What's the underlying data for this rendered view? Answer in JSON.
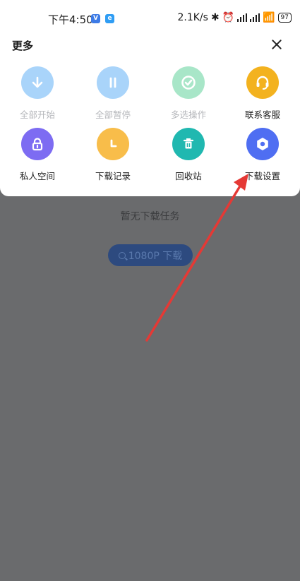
{
  "status_bar": {
    "time": "下午4:50",
    "app_icon_1": "V",
    "app_icon_2": "e",
    "net_speed": "2.1K/s",
    "battery": "97"
  },
  "header": {
    "title": "更多"
  },
  "menu": {
    "items": [
      {
        "label": "全部开始",
        "icon": "download-icon",
        "color": "#a9d4fa",
        "enabled": false
      },
      {
        "label": "全部暂停",
        "icon": "pause-icon",
        "color": "#a9d4fa",
        "enabled": false
      },
      {
        "label": "多选操作",
        "icon": "check-circle-icon",
        "color": "#a8e6c8",
        "enabled": false
      },
      {
        "label": "联系客服",
        "icon": "headset-icon",
        "color": "#f3b21f",
        "enabled": true
      },
      {
        "label": "私人空间",
        "icon": "lock-icon",
        "color": "#7d6cf2",
        "enabled": true
      },
      {
        "label": "下载记录",
        "icon": "clock-icon",
        "color": "#f8bd4a",
        "enabled": true
      },
      {
        "label": "回收站",
        "icon": "trash-icon",
        "color": "#20b8b0",
        "enabled": true
      },
      {
        "label": "下载设置",
        "icon": "gear-icon",
        "color": "#4f6ef2",
        "enabled": true
      }
    ]
  },
  "background": {
    "empty_text": "暂无下载任务",
    "download_button": "1080P 下载"
  },
  "annotation": {
    "color": "#e53935",
    "points_to": "下载设置"
  }
}
